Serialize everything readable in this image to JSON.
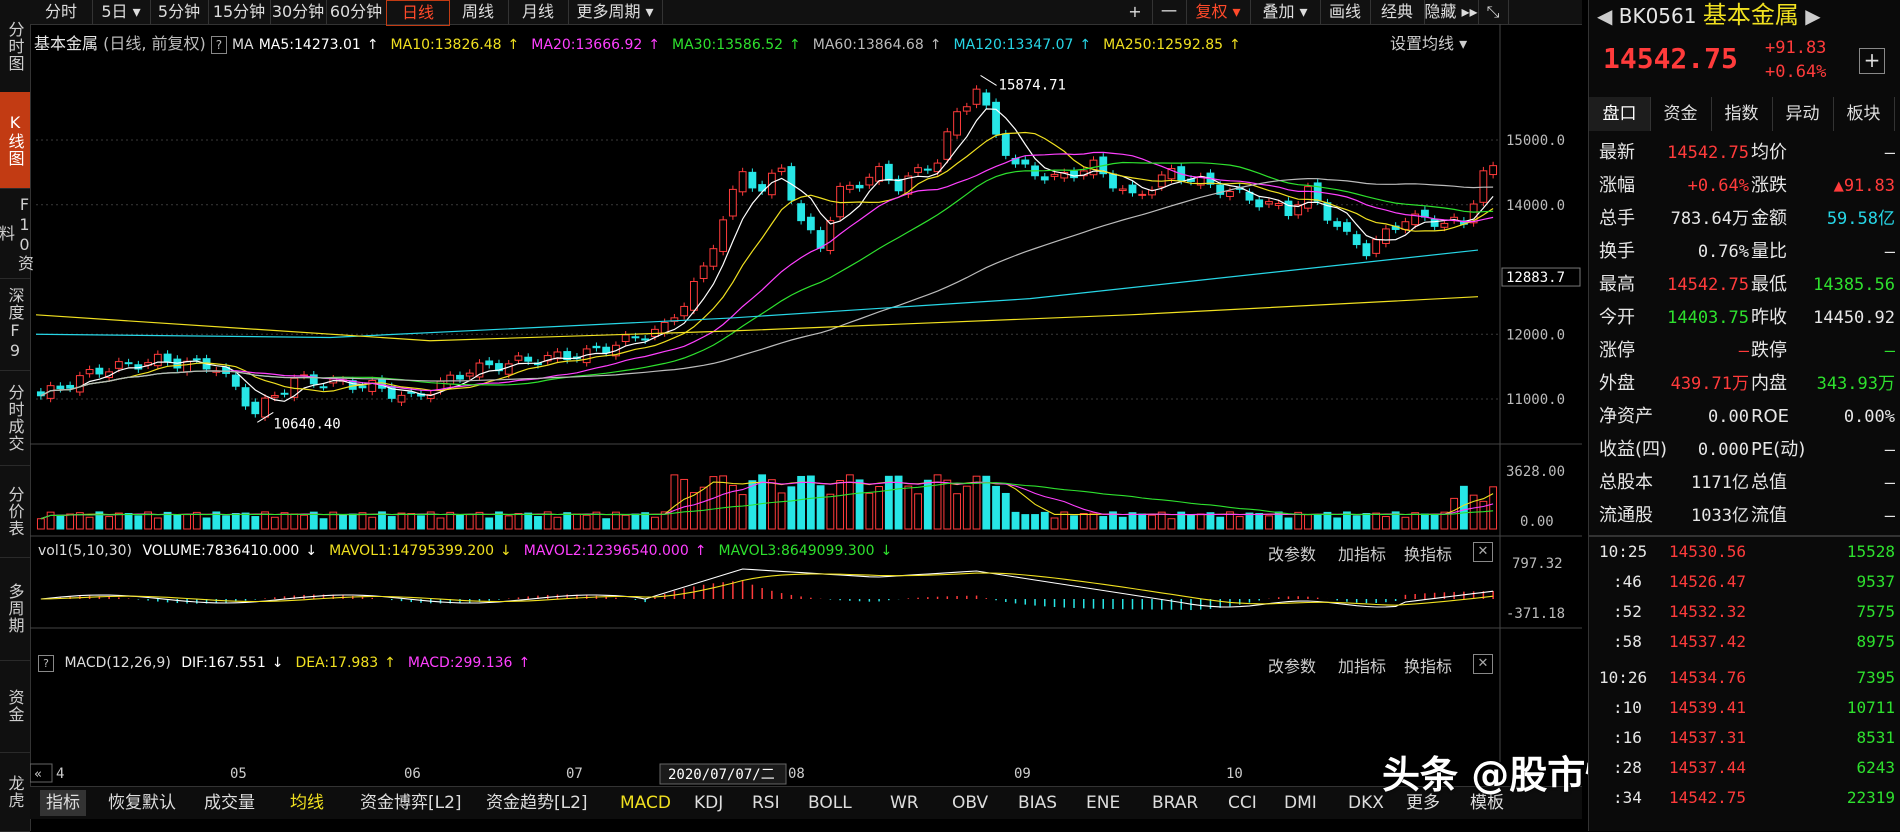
{
  "left_tabs": [
    "分时图",
    "K线图",
    "F10资料",
    "深度F9",
    "分时成交",
    "分价表",
    "多周期",
    "资金",
    "龙虎"
  ],
  "left_tab_active": 1,
  "periods": [
    "分时",
    "5日 ▾",
    "5分钟",
    "15分钟",
    "30分钟",
    "60分钟",
    "日线",
    "周线",
    "月线",
    "更多周期 ▾"
  ],
  "period_active": 6,
  "toolbar_right": [
    "+",
    "一",
    "复权 ▾",
    "叠加 ▾",
    "画线",
    "经典",
    "隐藏 ▸▸",
    "⤡"
  ],
  "chart_title": "基本金属",
  "chart_sub": "(日线, 前复权)",
  "help": "?",
  "ma_label": "MA",
  "ma_items": [
    {
      "text": "MA5:14273.01",
      "arrow": "↑",
      "color": "#ffffff"
    },
    {
      "text": "MA10:13826.48",
      "arrow": "↑",
      "color": "#f0e020"
    },
    {
      "text": "MA20:13666.92",
      "arrow": "↑",
      "color": "#ff40ff"
    },
    {
      "text": "MA30:13586.52",
      "arrow": "↑",
      "color": "#2ee02e"
    },
    {
      "text": "MA60:13864.68",
      "arrow": "↑",
      "color": "#bbbbbb"
    },
    {
      "text": "MA120:13347.07",
      "arrow": "↑",
      "color": "#27d6e6"
    },
    {
      "text": "MA250:12592.85",
      "arrow": "↑",
      "color": "#f0e020"
    }
  ],
  "set_ma": "设置均线 ▾",
  "price_axis": [
    "15000.0",
    "14000.0",
    "12883.7",
    "12000.0",
    "11000.0"
  ],
  "high_label": "15874.71",
  "low_label": "10640.40",
  "vol_legend": {
    "name": "vol1(5,10,30)",
    "items": [
      {
        "text": "VOLUME:7836410.000",
        "arrow": "↓",
        "color": "#ffffff"
      },
      {
        "text": "MAVOL1:14795399.200",
        "arrow": "↓",
        "color": "#f0e020"
      },
      {
        "text": "MAVOL2:12396540.000",
        "arrow": "↑",
        "color": "#ff40ff"
      },
      {
        "text": "MAVOL3:8649099.300",
        "arrow": "↓",
        "color": "#2ee02e"
      }
    ]
  },
  "vol_axis": [
    "3628.00",
    "0.00"
  ],
  "panel_actions": [
    "改参数",
    "加指标",
    "换指标"
  ],
  "macd_legend": {
    "name": "MACD(12,26,9)",
    "items": [
      {
        "text": "DIF:167.551",
        "arrow": "↓",
        "color": "#ffffff"
      },
      {
        "text": "DEA:17.983",
        "arrow": "↑",
        "color": "#f0e020"
      },
      {
        "text": "MACD:299.136",
        "arrow": "↑",
        "color": "#ff40ff"
      }
    ]
  },
  "macd_axis": [
    "797.32",
    "-371.18"
  ],
  "x_axis": {
    "first": "4",
    "labels": [
      "05",
      "06",
      "07",
      "08",
      "09",
      "10"
    ],
    "cursor": "2020/07/07/二"
  },
  "indicators": [
    "指标",
    "恢复默认",
    "成交量",
    "均线",
    "资金博弈[L2]",
    "资金趋势[L2]",
    "MACD",
    "KDJ",
    "RSI",
    "BOLL",
    "WR",
    "OBV",
    "BIAS",
    "ENE",
    "BRAR",
    "CCI",
    "DMI",
    "DKX",
    "更多",
    "模板"
  ],
  "watermark": "头条 @股市情感解析员",
  "stock": {
    "code": "BK0561",
    "name": "基本金属",
    "price": "14542.75",
    "change": "+91.83",
    "pct": "+0.64%",
    "add": "+"
  },
  "panel_tabs": [
    "盘口",
    "资金",
    "指数",
    "异动",
    "板块"
  ],
  "quote_rows": [
    {
      "l1": "最新",
      "v1": "14542.75",
      "c1": "red",
      "l2": "均价",
      "v2": "—",
      "c2": "white"
    },
    {
      "l1": "涨幅",
      "v1": "+0.64%",
      "c1": "red",
      "l2": "涨跌",
      "v2": "▲91.83",
      "c2": "red"
    },
    {
      "l1": "总手",
      "v1": "783.64万",
      "c1": "white",
      "l2": "金额",
      "v2": "59.58亿",
      "c2": "cyan"
    },
    {
      "l1": "换手",
      "v1": "0.76%",
      "c1": "white",
      "l2": "量比",
      "v2": "—",
      "c2": "white"
    },
    {
      "l1": "最高",
      "v1": "14542.75",
      "c1": "red",
      "l2": "最低",
      "v2": "14385.56",
      "c2": "green"
    },
    {
      "l1": "今开",
      "v1": "14403.75",
      "c1": "green",
      "l2": "昨收",
      "v2": "14450.92",
      "c2": "white"
    },
    {
      "l1": "涨停",
      "v1": "—",
      "c1": "red",
      "l2": "跌停",
      "v2": "—",
      "c2": "green"
    },
    {
      "l1": "外盘",
      "v1": "439.71万",
      "c1": "red",
      "l2": "内盘",
      "v2": "343.93万",
      "c2": "green"
    },
    {
      "l1": "净资产",
      "v1": "0.00",
      "c1": "white",
      "l2": "ROE",
      "v2": "0.00%",
      "c2": "white"
    },
    {
      "l1": "收益(四)",
      "v1": "0.000",
      "c1": "white",
      "l2": "PE(动)",
      "v2": "—",
      "c2": "white"
    },
    {
      "l1": "总股本",
      "v1": "1171亿",
      "c1": "white",
      "l2": "总值",
      "v2": "—",
      "c2": "white"
    },
    {
      "l1": "流通股",
      "v1": "1033亿",
      "c1": "white",
      "l2": "流值",
      "v2": "—",
      "c2": "white"
    }
  ],
  "ticks": [
    {
      "t": "10:25",
      "p": "14530.56",
      "v": "15528"
    },
    {
      "t": ":46",
      "p": "14526.47",
      "v": "9537"
    },
    {
      "t": ":52",
      "p": "14532.32",
      "v": "7575"
    },
    {
      "t": ":58",
      "p": "14537.42",
      "v": "8975"
    },
    {
      "t": "10:26",
      "p": "14534.76",
      "v": "7395"
    },
    {
      "t": ":10",
      "p": "14539.41",
      "v": "10711"
    },
    {
      "t": ":16",
      "p": "14537.31",
      "v": "8531"
    },
    {
      "t": ":28",
      "p": "14537.44",
      "v": "6243"
    },
    {
      "t": ":34",
      "p": "14542.75",
      "v": "22319"
    }
  ]
}
